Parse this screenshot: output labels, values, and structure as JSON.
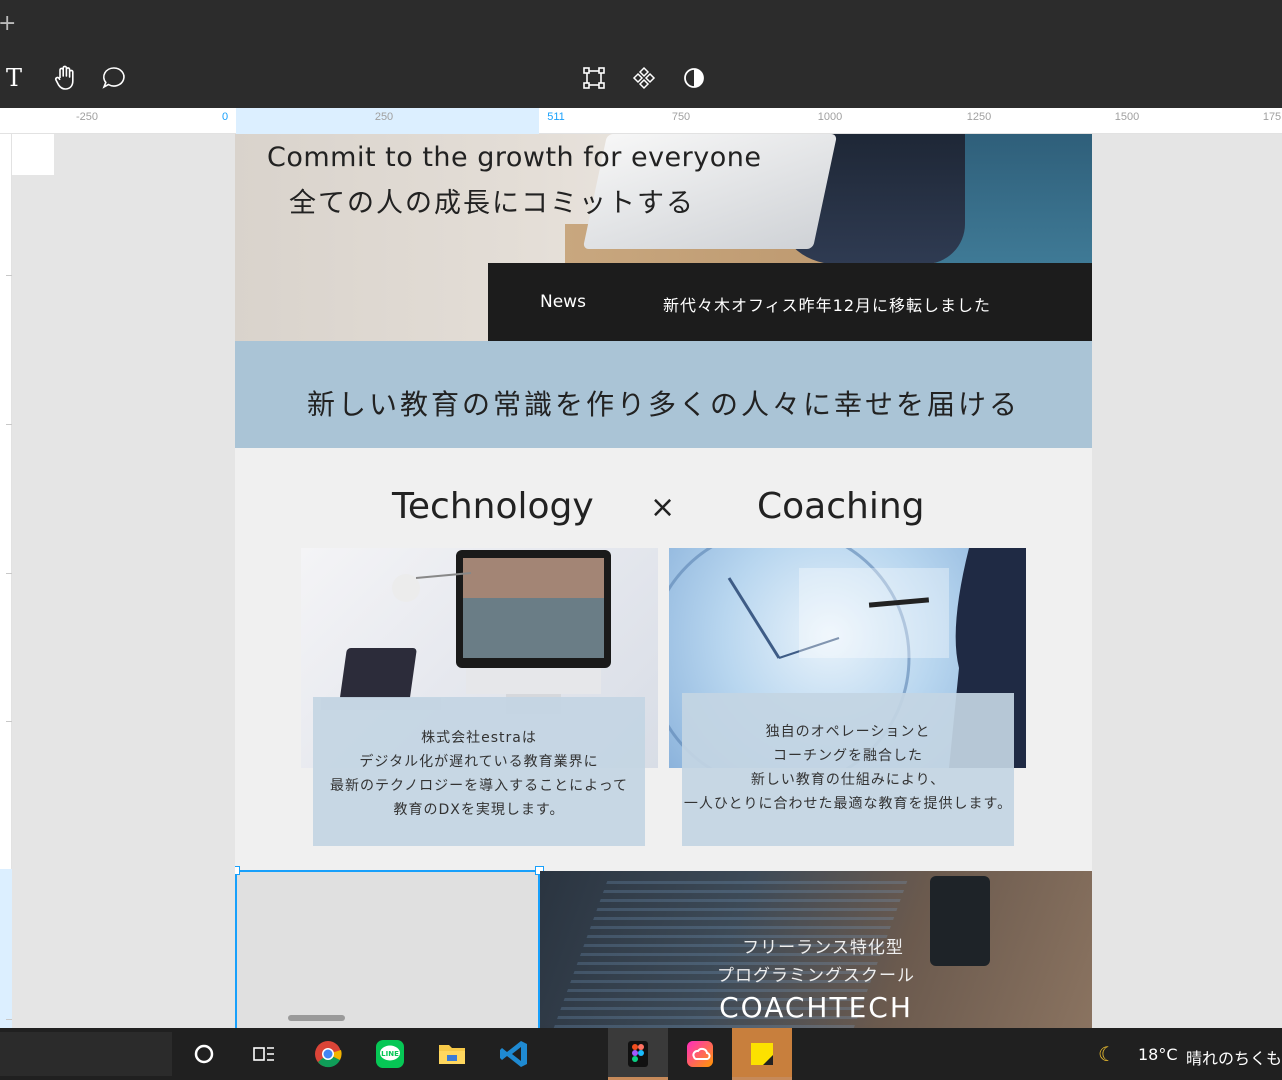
{
  "tabbar": {
    "add_label": "+"
  },
  "toolbar": {
    "left_tools": [
      "text-tool",
      "hand-tool",
      "comment-tool"
    ],
    "center_tools": [
      "frame-tool",
      "component-tool",
      "contrast-tool"
    ],
    "text_tool_glyph": "T"
  },
  "ruler": {
    "labels": [
      "-250",
      "0",
      "250",
      "511",
      "750",
      "1000",
      "1250",
      "1500",
      "175"
    ]
  },
  "frame": {
    "hero": {
      "title_en": "Commit to the growth for everyone",
      "title_ja": "全ての人の成長にコミットする"
    },
    "news": {
      "label": "News",
      "text": "新代々木オフィス昨年12月に移転しました"
    },
    "mission": "新しい教育の常識を作り多くの人々に幸せを届ける",
    "tc": {
      "left": "Technology",
      "times": "×",
      "right": "Coaching"
    },
    "cards": [
      {
        "lines": [
          "株式会社estraは",
          "デジタル化が遅れている教育業界に",
          "最新のテクノロジーを導入することによって",
          "教育のDXを実現します。"
        ]
      },
      {
        "lines": [
          "独自のオペレーションと",
          "コーチングを融合した",
          "新しい教育の仕組みにより、",
          "一人ひとりに合わせた最適な教育を提供します。"
        ]
      }
    ],
    "school": {
      "sub1": "フリーランス特化型",
      "sub2": "プログラミングスクール",
      "title": "COACHTECH"
    }
  },
  "taskbar": {
    "apps": [
      "cortana",
      "task-view",
      "chrome",
      "line",
      "file-explorer",
      "vscode",
      "figma",
      "creative-cloud",
      "sticky-notes"
    ],
    "weather": {
      "temp": "18°C",
      "condition": "晴れのちくもり"
    }
  },
  "colors": {
    "accent": "#18a0fb",
    "mission_bg": "#aac4d6",
    "news_bg": "#1c1c1c",
    "toolbar_bg": "#2c2c2c"
  }
}
